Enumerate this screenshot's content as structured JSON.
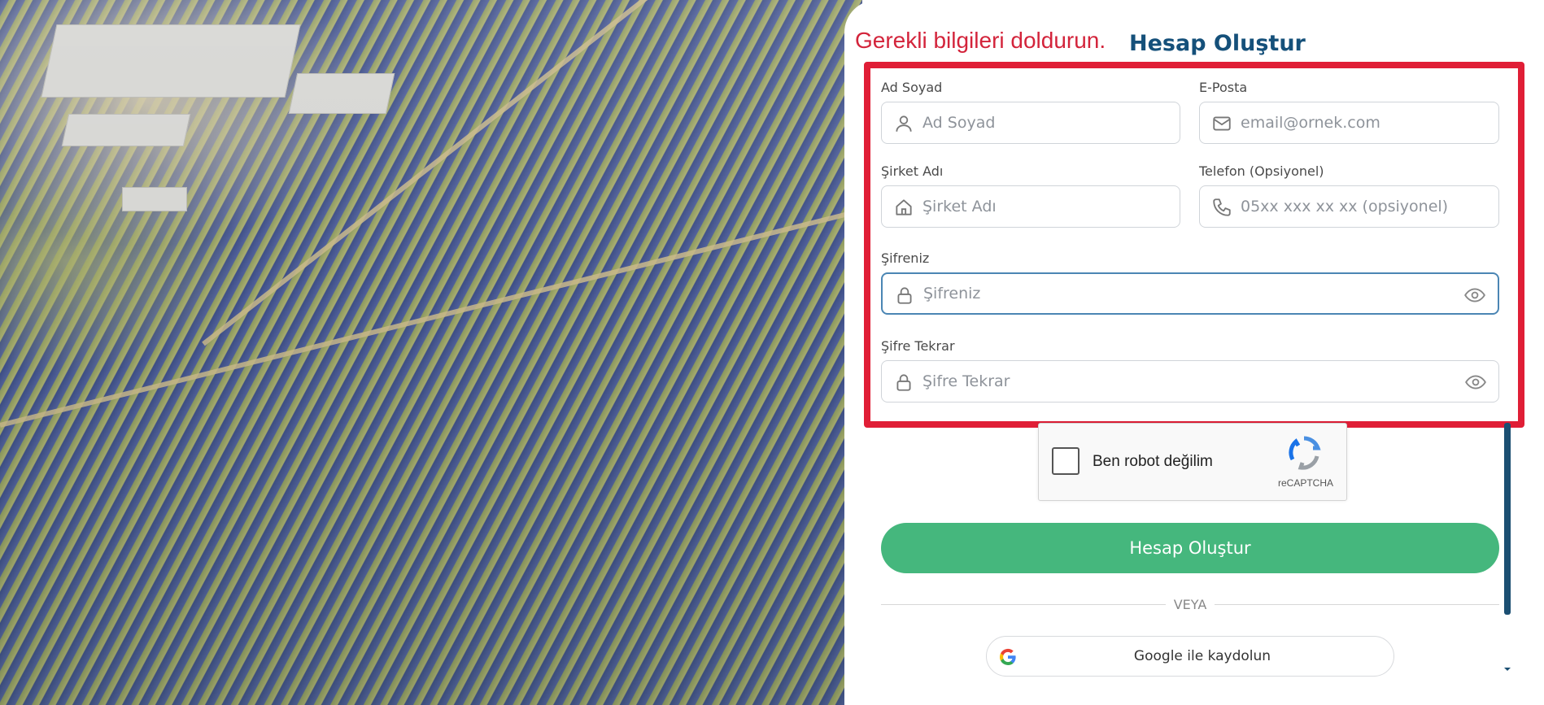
{
  "header": {
    "helper_text": "Gerekli bilgileri doldurun.",
    "title": "Hesap Oluştur"
  },
  "form": {
    "name": {
      "label": "Ad Soyad",
      "placeholder": "Ad Soyad",
      "value": "",
      "icon": "user-icon"
    },
    "email": {
      "label": "E-Posta",
      "placeholder": "email@ornek.com",
      "value": "",
      "icon": "mail-icon"
    },
    "company": {
      "label": "Şirket Adı",
      "placeholder": "Şirket Adı",
      "value": "",
      "icon": "home-icon"
    },
    "phone": {
      "label": "Telefon (Opsiyonel)",
      "placeholder": "05xx xxx xx xx (opsiyonel)",
      "value": "",
      "icon": "phone-icon"
    },
    "password": {
      "label": "Şifreniz",
      "placeholder": "Şifreniz",
      "value": "",
      "icon": "lock-icon",
      "focused": true
    },
    "password_confirm": {
      "label": "Şifre Tekrar",
      "placeholder": "Şifre Tekrar",
      "value": "",
      "icon": "lock-icon"
    }
  },
  "captcha": {
    "label": "Ben robot değilim",
    "brand": "reCAPTCHA",
    "checked": false
  },
  "actions": {
    "submit_label": "Hesap Oluştur",
    "divider_text": "VEYA",
    "google_label": "Google ile kaydolun"
  },
  "colors": {
    "helper_text": "#d3243b",
    "title": "#15507a",
    "highlight_border": "#e01e36",
    "submit_bg": "#45b77d",
    "focus_border": "#4b86b4",
    "scroll_thumb": "#1b4f72"
  }
}
